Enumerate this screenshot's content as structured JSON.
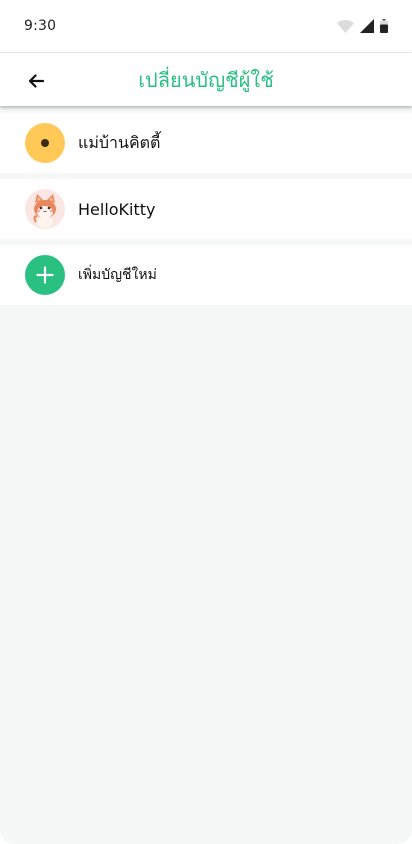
{
  "status_bar": {
    "time": "9:30",
    "icons": [
      "wifi-icon",
      "signal-icon",
      "battery-icon"
    ]
  },
  "header": {
    "title": "เปลี่ยนบัญชีผู้ใช้",
    "back_icon": "arrow-left-icon"
  },
  "accounts": [
    {
      "name": "แม่บ้านคิตตี้",
      "avatar": "sunflower-avatar"
    },
    {
      "name": "HelloKitty",
      "avatar": "cat-avatar"
    }
  ],
  "add_account": {
    "label": "เพิ่มบัญชีใหม่",
    "icon": "plus-icon"
  },
  "colors": {
    "accent": "#2ac082",
    "avatar_yellow": "#ffc857",
    "background": "#f6f8f8"
  }
}
